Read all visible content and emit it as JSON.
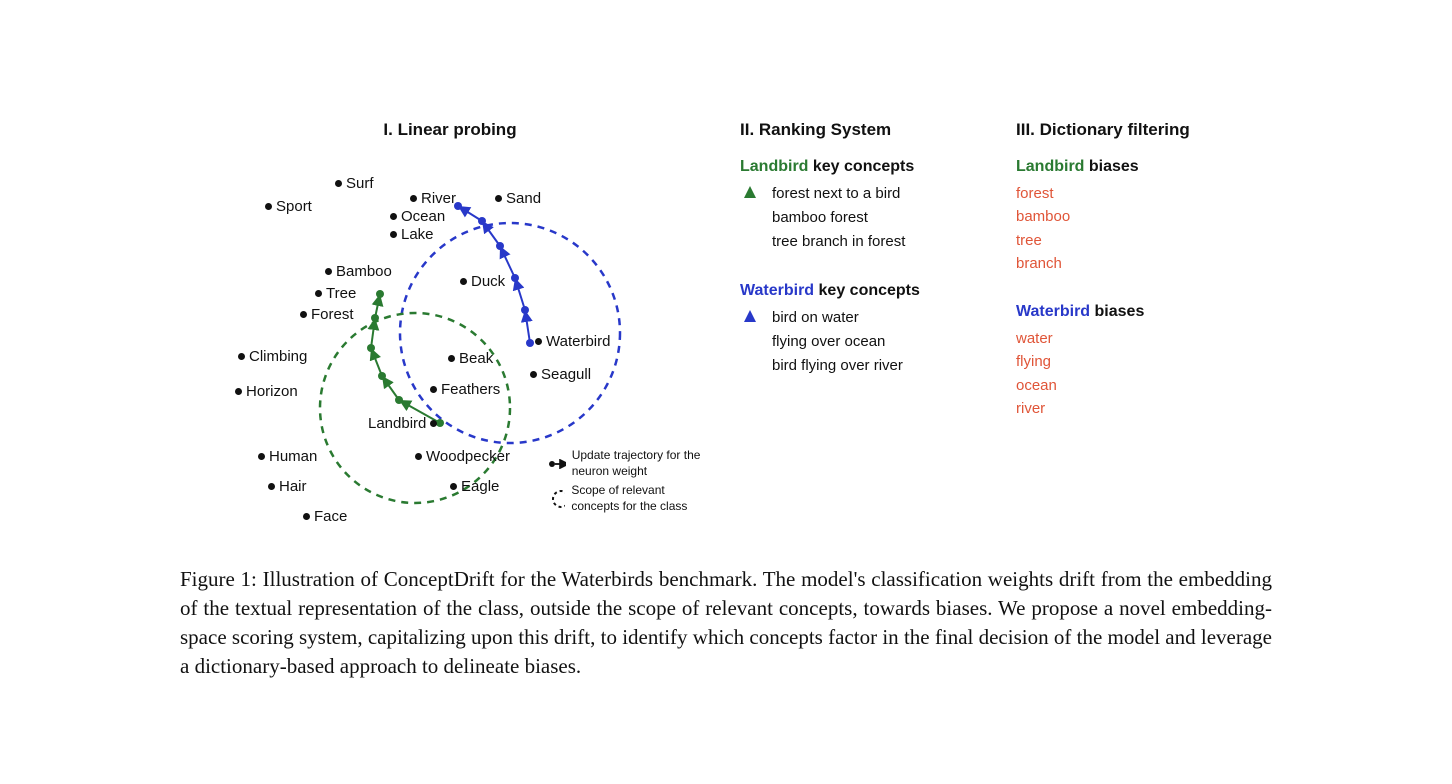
{
  "panel1": {
    "title": "I. Linear probing",
    "points": {
      "surf": "Surf",
      "river": "River",
      "sand": "Sand",
      "sport": "Sport",
      "ocean": "Ocean",
      "lake": "Lake",
      "bamboo": "Bamboo",
      "tree": "Tree",
      "forest": "Forest",
      "duck": "Duck",
      "waterbird": "Waterbird",
      "climbing": "Climbing",
      "beak": "Beak",
      "seagull": "Seagull",
      "horizon": "Horizon",
      "feathers": "Feathers",
      "landbird": "Landbird",
      "woodpecker": "Woodpecker",
      "human": "Human",
      "eagle": "Eagle",
      "hair": "Hair",
      "face": "Face"
    },
    "legend": {
      "update": "Update trajectory for the neuron weight",
      "scope": "Scope of relevant concepts for the class"
    }
  },
  "panel2": {
    "title": "II. Ranking System",
    "landbird_head_green": "Landbird",
    "landbird_head_rest": " key concepts",
    "landbird_items": {
      "0": "forest next to a bird",
      "1": "bamboo forest",
      "2": "tree branch in forest"
    },
    "waterbird_head_blue": "Waterbird",
    "waterbird_head_rest": " key concepts",
    "waterbird_items": {
      "0": "bird on water",
      "1": "flying over ocean",
      "2": "bird flying over river"
    }
  },
  "panel3": {
    "title": "III. Dictionary filtering",
    "landbird_head_green": "Landbird",
    "landbird_head_rest": " biases",
    "landbird_biases": {
      "0": "forest",
      "1": "bamboo",
      "2": "tree",
      "3": "branch"
    },
    "waterbird_head_blue": "Waterbird",
    "waterbird_head_rest": " biases",
    "waterbird_biases": {
      "0": "water",
      "1": "flying",
      "2": "ocean",
      "3": "river"
    }
  },
  "caption": "Figure 1: Illustration of ConceptDrift for the Waterbirds benchmark. The model's classification weights drift from the embedding of the textual representation of the class, outside the scope of relevant concepts, towards biases. We propose a novel embedding-space scoring system, capitalizing upon this drift, to identify which concepts factor in the final decision of the model and leverage a dictionary-based approach to delineate biases."
}
